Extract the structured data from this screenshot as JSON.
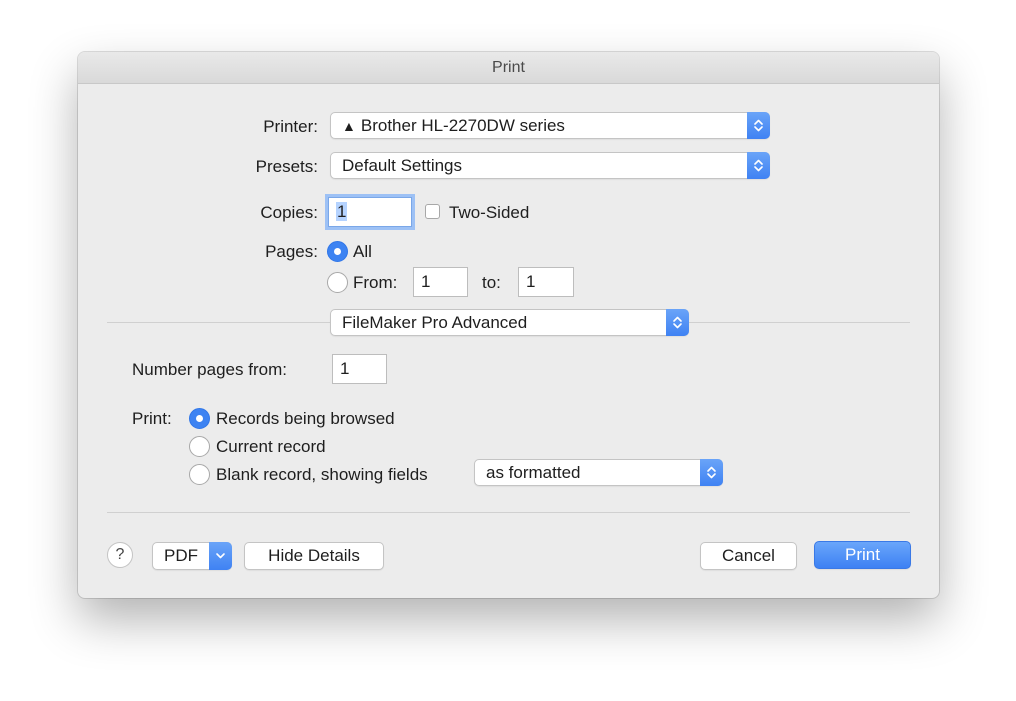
{
  "window": {
    "title": "Print"
  },
  "printer": {
    "label": "Printer:",
    "warning_icon": "▲",
    "value": "Brother HL-2270DW series"
  },
  "presets": {
    "label": "Presets:",
    "value": "Default Settings"
  },
  "copies": {
    "label": "Copies:",
    "value": "1",
    "two_sided_label": "Two-Sided",
    "two_sided_checked": false
  },
  "pages": {
    "label": "Pages:",
    "all_label": "All",
    "from_label": "From:",
    "from_value": "1",
    "to_label": "to:",
    "to_value": "1",
    "selected": "All"
  },
  "section_popup": {
    "value": "FileMaker Pro Advanced"
  },
  "number_pages": {
    "label": "Number pages from:",
    "value": "1"
  },
  "print_options": {
    "label": "Print:",
    "records_browsed": "Records being browsed",
    "current_record": "Current record",
    "blank_record": "Blank record, showing fields",
    "selected": "Records being browsed",
    "blank_format_value": "as formatted"
  },
  "footer": {
    "help_label": "?",
    "pdf_label": "PDF",
    "hide_details_label": "Hide Details",
    "cancel_label": "Cancel",
    "print_label": "Print"
  },
  "colors": {
    "accent": "#3d83f2",
    "window_bg": "#ececec"
  }
}
